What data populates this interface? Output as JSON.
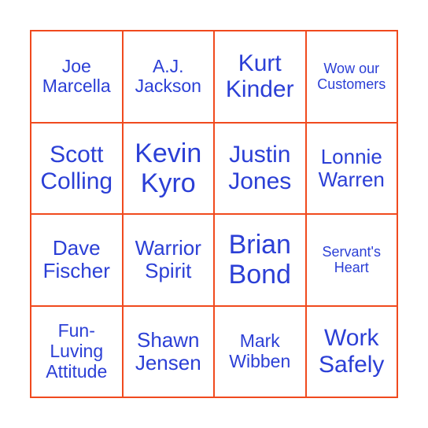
{
  "colors": {
    "border": "#F04A1E",
    "text": "#2B3FD6",
    "background": "#ffffff"
  },
  "board": {
    "cells": [
      {
        "text": "Joe Marcella",
        "size": "md"
      },
      {
        "text": "A.J. Jackson",
        "size": "md"
      },
      {
        "text": "Kurt Kinder",
        "size": "lg"
      },
      {
        "text": "Wow our Customers",
        "size": "sm"
      },
      {
        "text": "Scott Colling",
        "size": "lg"
      },
      {
        "text": "Kevin Kyro",
        "size": "xl"
      },
      {
        "text": "Justin Jones",
        "size": "lg"
      },
      {
        "text": "Lonnie Warren",
        "size": "md2"
      },
      {
        "text": "Dave Fischer",
        "size": "md2"
      },
      {
        "text": "Warrior Spirit",
        "size": "md2"
      },
      {
        "text": "Brian Bond",
        "size": "xl"
      },
      {
        "text": "Servant's Heart",
        "size": "sm"
      },
      {
        "text": "Fun-Luving Attitude",
        "size": "md"
      },
      {
        "text": "Shawn Jensen",
        "size": "md2"
      },
      {
        "text": "Mark Wibben",
        "size": "md"
      },
      {
        "text": "Work Safely",
        "size": "lg"
      }
    ]
  }
}
